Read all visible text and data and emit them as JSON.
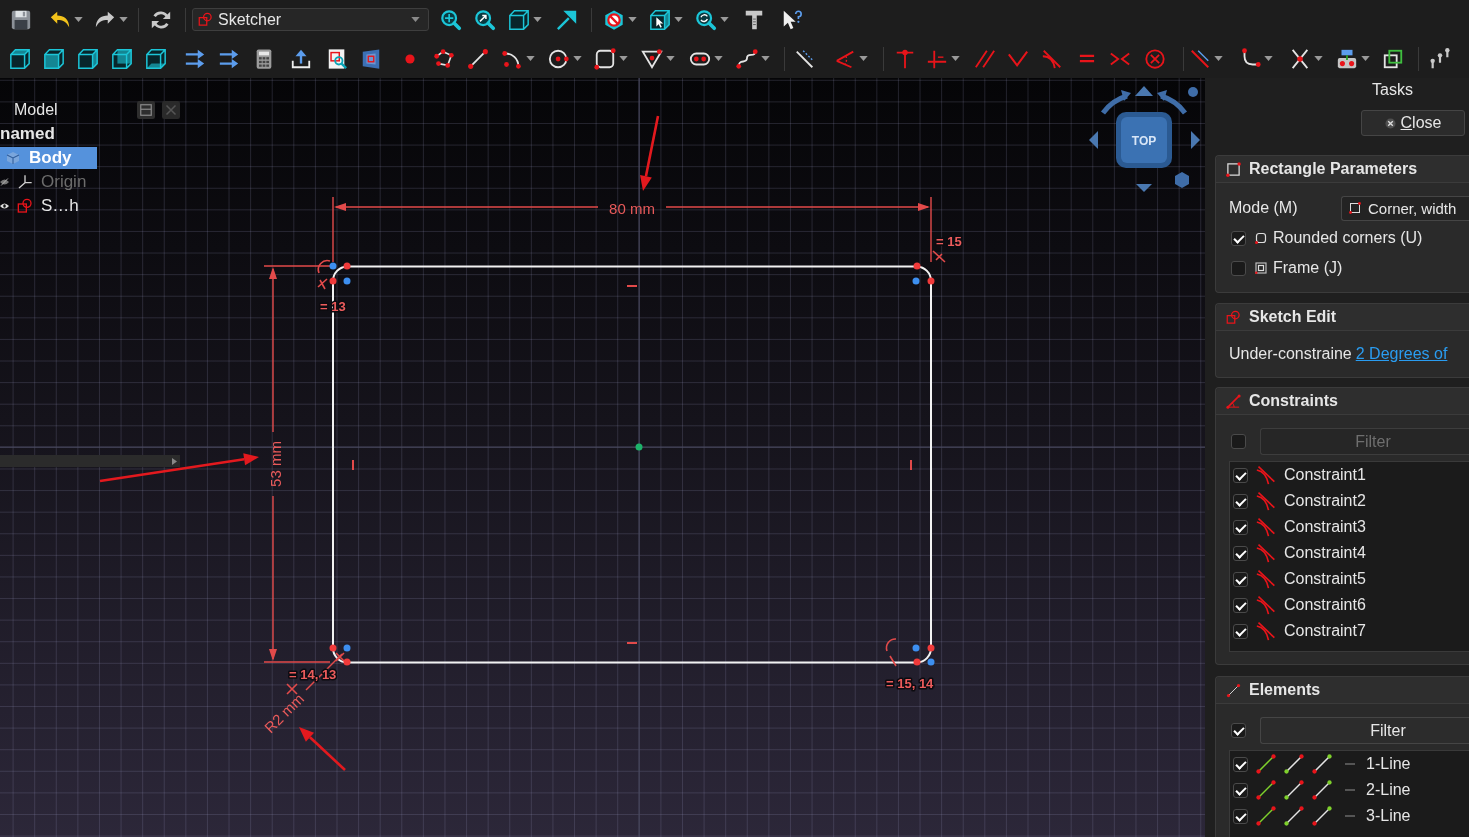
{
  "toolbar": {
    "workbench": "Sketcher"
  },
  "tree": {
    "title": "Model",
    "items": [
      {
        "label": "named",
        "kind": "document",
        "selected": false,
        "children": [
          {
            "label": "Body",
            "kind": "body",
            "selected": true,
            "children": [
              {
                "label": "Origin",
                "kind": "origin",
                "selected": false,
                "visible": false
              },
              {
                "label": "S…h",
                "kind": "sketch",
                "selected": false,
                "visible": true
              }
            ]
          }
        ]
      }
    ]
  },
  "navigation_cube": {
    "face": "TOP"
  },
  "sketch": {
    "labels": [
      {
        "text": "80 mm",
        "kind": "dimension"
      },
      {
        "text": "53 mm",
        "kind": "dimension"
      },
      {
        "text": "= 15",
        "kind": "equality"
      },
      {
        "text": "= 13",
        "kind": "equality"
      },
      {
        "text": "= 14, 13",
        "kind": "equality"
      },
      {
        "text": "= 15, 14",
        "kind": "equality"
      },
      {
        "text": "R2 mm",
        "kind": "dimension"
      }
    ]
  },
  "tasks": {
    "title": "Tasks",
    "close_button": "Close",
    "rectangle_parameters": {
      "title": "Rectangle Parameters",
      "mode_label": "Mode (M)",
      "mode_value": "Corner, width",
      "options": [
        {
          "label": "Rounded corners (U)",
          "checked": true
        },
        {
          "label": "Frame (J)",
          "checked": false
        }
      ]
    },
    "sketch_edit": {
      "title": "Sketch Edit",
      "status": "Under-constraine",
      "link": "2 Degrees of"
    },
    "constraints": {
      "title": "Constraints",
      "filter_checked": false,
      "filter_placeholder": "Filter",
      "items": [
        {
          "label": "Constraint1",
          "checked": true
        },
        {
          "label": "Constraint2",
          "checked": true
        },
        {
          "label": "Constraint3",
          "checked": true
        },
        {
          "label": "Constraint4",
          "checked": true
        },
        {
          "label": "Constraint5",
          "checked": true
        },
        {
          "label": "Constraint6",
          "checked": true
        },
        {
          "label": "Constraint7",
          "checked": true
        }
      ]
    },
    "elements": {
      "title": "Elements",
      "filter_checked": true,
      "filter_button": "Filter",
      "items": [
        {
          "label": "1-Line",
          "checked": true
        },
        {
          "label": "2-Line",
          "checked": true
        },
        {
          "label": "3-Line",
          "checked": true
        }
      ]
    }
  }
}
